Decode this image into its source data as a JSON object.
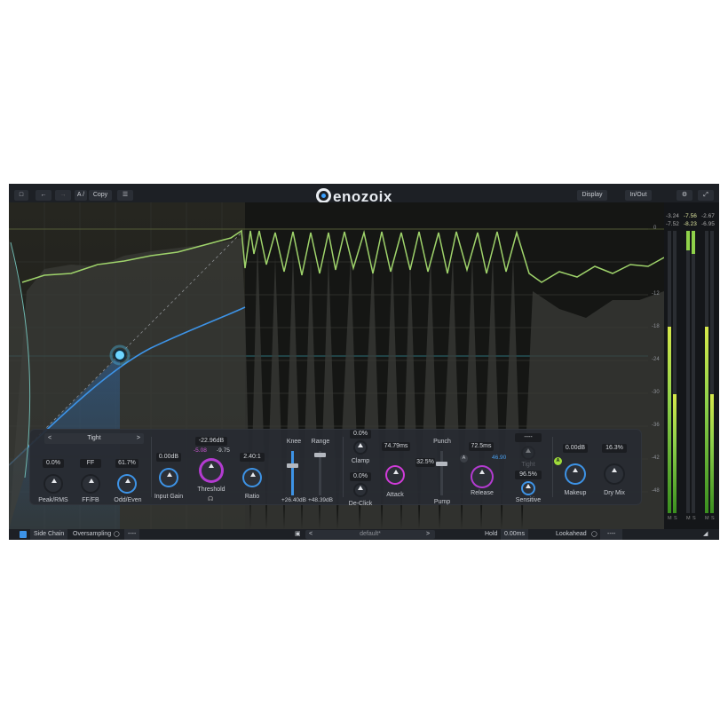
{
  "topbar": {
    "folder_icon": "folder-icon",
    "undo_icon": "undo-icon",
    "redo_icon": "redo-icon",
    "ab_label": "A /",
    "copy_label": "Copy",
    "menu_icon": "hamburger-icon",
    "logo_text": "enozoix",
    "display_label": "Display",
    "inout_label": "In/Out",
    "settings_icon": "gear-icon",
    "expand_icon": "expand-icon"
  },
  "graph": {
    "db_scale": [
      "0",
      "-6",
      "-12",
      "-18",
      "-24",
      "-30",
      "-36",
      "-42",
      "-48"
    ]
  },
  "meters": {
    "in_top": [
      "-3.24",
      "-7.52"
    ],
    "gr_top": [
      "-7.56",
      "-8.23"
    ],
    "out_top": [
      "-2.67",
      "-6.95"
    ],
    "ms_labels": [
      "M",
      "S",
      "M",
      "S",
      "M",
      "S"
    ],
    "levels": {
      "in_m": 0.66,
      "in_s": 0.42,
      "out_m": 0.66,
      "out_s": 0.42
    }
  },
  "controls": {
    "detector": {
      "mode": "Tight",
      "peak_rms_value": "0.0%",
      "peak_rms_label": "Peak/RMS",
      "ff_fb_value": "FF",
      "ff_fb_label": "FF/FB",
      "odd_even_value": "61.7%",
      "odd_even_label": "Odd/Even"
    },
    "input_gain": {
      "value": "0.00dB",
      "label": "Input Gain"
    },
    "threshold": {
      "value": "-22.96dB",
      "left": "-5.08",
      "right": "-9.75",
      "label": "Threshold",
      "headphone_icon": "headphones-icon"
    },
    "ratio": {
      "value": "2.40:1",
      "label": "Ratio"
    },
    "knee": {
      "label": "Knee",
      "value": "+26.40dB"
    },
    "range": {
      "label": "Range",
      "value": "+48.39dB"
    },
    "clamp": {
      "value": "0.0%",
      "label": "Clamp"
    },
    "declick": {
      "value": "0.0%",
      "label": "De-Click"
    },
    "attack": {
      "value": "74.79ms",
      "label": "Attack"
    },
    "punch": {
      "label": "Punch",
      "value": "32.5%",
      "pump_label": "Pump"
    },
    "release": {
      "value": "72.5ms",
      "auto_value": "46.90",
      "auto_badge": "A",
      "label": "Release"
    },
    "tight": {
      "value": "----",
      "label": "Tight"
    },
    "sensitive": {
      "value": "96.5%",
      "label": "Sensitive"
    },
    "makeup": {
      "value": "0.00dB",
      "auto_badge": "A",
      "label": "Makeup"
    },
    "dry_mix": {
      "value": "16.3%",
      "label": "Dry Mix"
    }
  },
  "bottombar": {
    "sidechain_label": "Side Chain",
    "oversampling_label": "Oversampling",
    "oversampling_value": "----",
    "preset_name": "default*",
    "hold_label": "Hold",
    "hold_value": "0.00ms",
    "lookahead_label": "Lookahead",
    "lookahead_value": "----"
  }
}
